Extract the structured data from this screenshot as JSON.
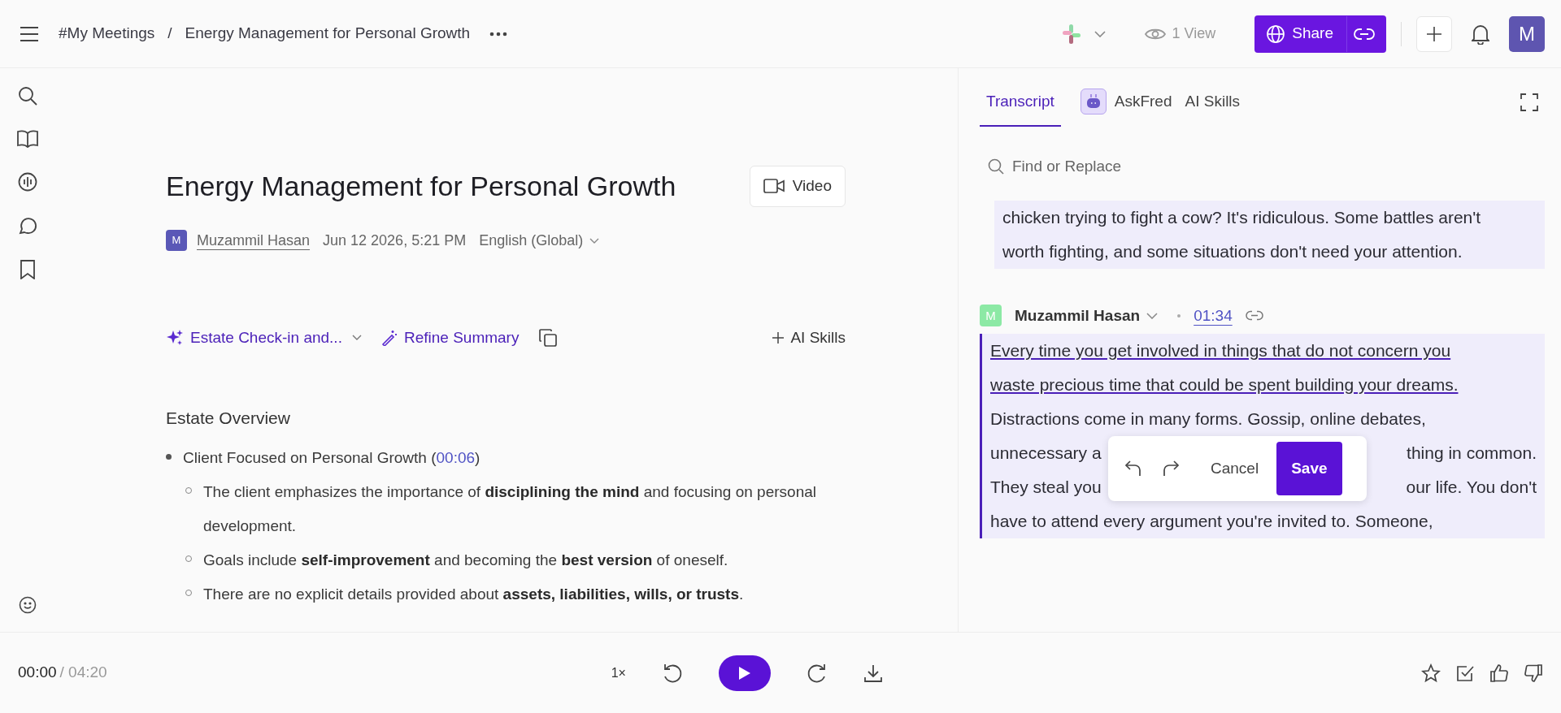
{
  "breadcrumb": {
    "workspace": "#My Meetings",
    "separator": "/",
    "page": "Energy Management for Personal Growth"
  },
  "header": {
    "views": "1 View",
    "share": "Share",
    "avatar": "M"
  },
  "meeting": {
    "title": "Energy Management for Personal Growth",
    "video": "Video",
    "owner_initial": "M",
    "owner": "Muzammil Hasan",
    "date": "Jun 12 2026, 5:21 PM",
    "language": "English (Global)"
  },
  "summary_toolbar": {
    "template": "Estate Check-in and...",
    "refine": "Refine Summary",
    "ai_skills": "AI Skills"
  },
  "summary": {
    "heading": "Estate Overview",
    "items": [
      {
        "prefix": "Client Focused on Personal Growth (",
        "timestamp": "00:06",
        "suffix": ")",
        "children": [
          {
            "text": "The client emphasizes the importance of **disciplining the mind** and focusing on personal development."
          },
          {
            "text": "Goals include **self-improvement** and becoming the **best version** of oneself."
          },
          {
            "text": "There are no explicit details provided about **assets, liabilities, wills, or trusts**."
          }
        ]
      }
    ]
  },
  "panel_tabs": [
    {
      "label": "Transcript",
      "selected": true,
      "kind": "text"
    },
    {
      "label": "AskFred",
      "selected": false,
      "kind": "bot"
    },
    {
      "label": "AI Skills",
      "selected": false,
      "kind": "text"
    }
  ],
  "search": {
    "placeholder": "Find or Replace"
  },
  "transcript": [
    {
      "lines": [
        {
          "text": "chicken trying to fight a cow? It's ridiculous. Some battles aren't",
          "underlined": false
        },
        {
          "text": "worth fighting, and some situations don't need your attention.",
          "underlined": false
        }
      ]
    },
    {
      "speaker": {
        "initial": "M",
        "name": "Muzammil Hasan",
        "time": "01:34"
      },
      "editing": true,
      "lines": [
        {
          "text": "Every time you get involved in things that do not concern you",
          "underlined": true
        },
        {
          "text": "waste precious time that could be spent building your dreams.",
          "underlined": true
        },
        {
          "text": "Distractions come in many forms. Gossip, online debates,",
          "underlined": false
        },
        {
          "left": "unnecessary a",
          "right": "thing in common.",
          "underlined": false
        },
        {
          "left": "They steal you",
          "right": "our life. You don't",
          "underlined": false
        },
        {
          "text": "have to attend every argument you're invited to. Someone,",
          "underlined": false
        }
      ]
    }
  ],
  "edit_popup": {
    "cancel": "Cancel",
    "save": "Save"
  },
  "player": {
    "current": "00:00",
    "total": "/ 04:20",
    "speed": "1×"
  }
}
